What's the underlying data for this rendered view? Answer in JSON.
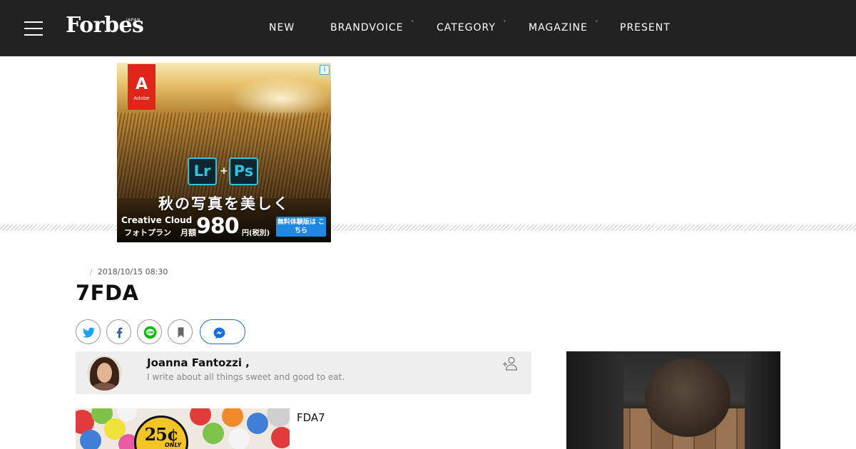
{
  "header": {
    "logo": "Forbes",
    "logo_sub": "JAPAN",
    "nav": [
      {
        "label": "NEW",
        "has_dropdown": false
      },
      {
        "label": "BRANDVOICE",
        "has_dropdown": true
      },
      {
        "label": "CATEGORY",
        "has_dropdown": true
      },
      {
        "label": "MAGAZINE",
        "has_dropdown": true
      },
      {
        "label": "PRESENT",
        "has_dropdown": false
      }
    ],
    "caret": "ˇ"
  },
  "ad": {
    "brand": "Adobe",
    "brand_mark": "A",
    "info_icon": "i",
    "app1": "Lr",
    "app2": "Ps",
    "plus": "+",
    "headline": "秋の写真を美しく",
    "product": "Creative Cloud",
    "plan": "フォトプラン",
    "monthly": "月額",
    "price": "980",
    "tax": "円(税別)",
    "cta": "無料体験版は こちら"
  },
  "article": {
    "breadcrumb_sep": "/",
    "date": "2018/10/15 08:30",
    "title": "7FDA"
  },
  "author": {
    "name": "Joanna Fantozzi ,",
    "bio": "I write about all things sweet and good to eat."
  },
  "related": {
    "label": "FDA7",
    "thumb_price": "25¢",
    "thumb_only": "ONLY"
  },
  "colors": {
    "topbar": "#222222",
    "twitter": "#1da1f2",
    "facebook": "#3b5998",
    "line": "#00b900",
    "messenger": "#1a6fd6",
    "adobe_red": "#e1251b",
    "ps_cyan": "#2fc5e0"
  }
}
